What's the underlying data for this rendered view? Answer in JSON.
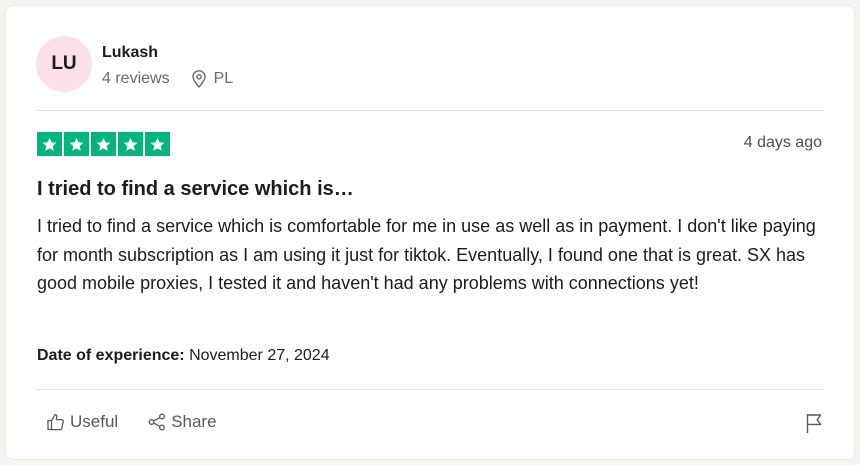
{
  "reviewer": {
    "initials": "LU",
    "name": "Lukash",
    "reviews_count": "4 reviews",
    "country": "PL"
  },
  "rating": {
    "stars": 5,
    "max_stars": 5,
    "star_color": "#00b67a"
  },
  "review": {
    "date": "4 days ago",
    "title": "I tried to find a service which is…",
    "body": "I tried to find a service which is comfortable for me in use as well as in payment. I don't like paying for month subscription as I am using it just for tiktok. Eventually, I found one that is great. SX has good mobile proxies, I tested it and haven't had any problems with connections yet!",
    "experience_label": "Date of experience:",
    "experience_date": "November 27, 2024"
  },
  "actions": {
    "useful_label": "Useful",
    "share_label": "Share"
  },
  "icons": {
    "location": "location-pin-icon",
    "useful": "thumbs-up-icon",
    "share": "share-icon",
    "report": "flag-icon",
    "star": "star-icon"
  },
  "colors": {
    "avatar_bg": "#fbe0e7",
    "page_bg": "#f5f4ef",
    "card_bg": "#ffffff"
  }
}
